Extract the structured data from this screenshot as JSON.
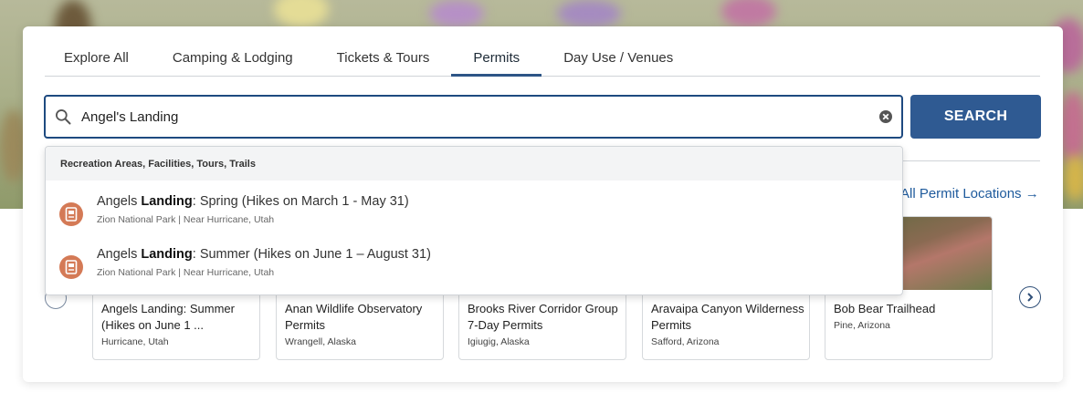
{
  "tabs": [
    {
      "label": "Explore All"
    },
    {
      "label": "Camping & Lodging"
    },
    {
      "label": "Tickets & Tours"
    },
    {
      "label": "Permits",
      "active": true
    },
    {
      "label": "Day Use / Venues"
    }
  ],
  "search": {
    "value": "Angel's Landing",
    "button_label": "SEARCH"
  },
  "all_permits_link": "All Permit Locations →",
  "dropdown": {
    "header": "Recreation Areas, Facilities, Tours, Trails",
    "items": [
      {
        "pre": "Angels ",
        "bold": "Landing",
        "post": ": Spring (Hikes on March 1 - May 31)",
        "sub": "Zion National Park | Near Hurricane, Utah",
        "icon": "ticket-icon"
      },
      {
        "pre": "Angels ",
        "bold": "Landing",
        "post": ": Summer (Hikes on June 1 – August 31)",
        "sub": "Zion National Park | Near Hurricane, Utah",
        "icon": "ticket-icon"
      }
    ]
  },
  "permit_cards": [
    {
      "title": "Angels Landing: Summer (Hikes on June 1 ...",
      "location": "Hurricane, Utah"
    },
    {
      "title": "Anan Wildlife Observatory Permits",
      "location": "Wrangell, Alaska"
    },
    {
      "title": "Brooks River Corridor Group 7-Day Permits",
      "location": "Igiugig, Alaska"
    },
    {
      "title": "Aravaipa Canyon Wilderness Permits",
      "location": "Safford, Arizona"
    },
    {
      "title": "Bob Bear Trailhead",
      "location": "Pine, Arizona"
    }
  ],
  "colors": {
    "accent": "#2f5a92",
    "link": "#1e5a9c",
    "ticket_icon": "#d47a56"
  },
  "icons": {
    "search": "search-icon",
    "clear": "clear-icon",
    "prev": "chevron-left-icon",
    "next": "chevron-right-icon"
  }
}
